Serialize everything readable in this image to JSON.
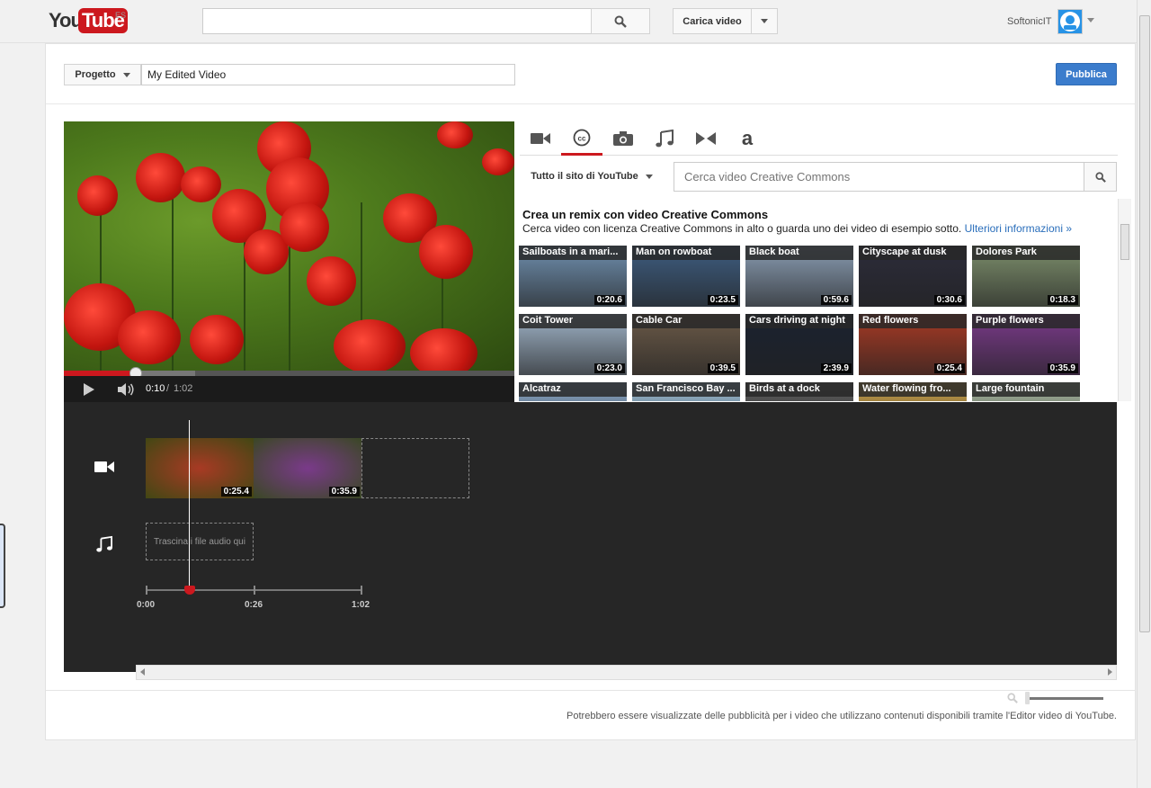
{
  "masthead": {
    "logo_you": "You",
    "logo_tube": "Tube",
    "region": "ES",
    "search_placeholder": "",
    "upload_label": "Carica video",
    "user_name": "SoftonicIT"
  },
  "project": {
    "menu_label": "Progetto",
    "name": "My Edited Video",
    "publish_label": "Pubblica"
  },
  "player": {
    "current_time": "0:10",
    "separator": "/",
    "duration": "1:02",
    "progress_fraction": 0.16
  },
  "tabs": [
    {
      "icon": "video-camera-icon",
      "active": false
    },
    {
      "icon": "creative-commons-icon",
      "active": true
    },
    {
      "icon": "photo-camera-icon",
      "active": false
    },
    {
      "icon": "music-note-icon",
      "active": false
    },
    {
      "icon": "transitions-icon",
      "active": false
    },
    {
      "icon": "text-icon",
      "active": false
    }
  ],
  "cc_panel": {
    "scope_label": "Tutto il sito di YouTube",
    "search_placeholder": "Cerca video Creative Commons",
    "intro_title": "Crea un remix con video Creative Commons",
    "intro_text": "Cerca video con licenza Creative Commons in alto o guarda uno dei video di esempio sotto.",
    "intro_link": "Ulteriori informazioni »",
    "videos": [
      {
        "title": "Sailboats in a mari...",
        "duration": "0:20.6",
        "color": "#6f8fae"
      },
      {
        "title": "Man on rowboat",
        "duration": "0:23.5",
        "color": "#3e5d80"
      },
      {
        "title": "Black boat",
        "duration": "0:59.6",
        "color": "#8a9db3"
      },
      {
        "title": "Cityscape at dusk",
        "duration": "0:30.6",
        "color": "#2c2c3a"
      },
      {
        "title": "Dolores Park",
        "duration": "0:18.3",
        "color": "#7d8f6c"
      },
      {
        "title": "Coit Tower",
        "duration": "0:23.0",
        "color": "#9fb3c7"
      },
      {
        "title": "Cable Car",
        "duration": "0:39.5",
        "color": "#6b5a48"
      },
      {
        "title": "Cars driving at night",
        "duration": "2:39.9",
        "color": "#1a2230"
      },
      {
        "title": "Red flowers",
        "duration": "0:25.4",
        "color": "#a83a24"
      },
      {
        "title": "Purple flowers",
        "duration": "0:35.9",
        "color": "#7a3a8a"
      },
      {
        "title": "Alcatraz",
        "duration": "",
        "color": "#8aa8c8"
      },
      {
        "title": "San Francisco Bay ...",
        "duration": "",
        "color": "#9ec0d8"
      },
      {
        "title": "Birds at a dock",
        "duration": "",
        "color": "#5c5c5c"
      },
      {
        "title": "Water flowing fro...",
        "duration": "",
        "color": "#c8a04a"
      },
      {
        "title": "Large fountain",
        "duration": "",
        "color": "#a8b8a0"
      }
    ]
  },
  "timeline": {
    "clips": [
      {
        "duration": "0:25.4",
        "color": "#a83a24"
      },
      {
        "duration": "0:35.9",
        "color": "#7a3a8a"
      }
    ],
    "audio_drop_label": "Trascina i file audio qui",
    "ruler_labels": [
      "0:00",
      "0:26",
      "1:02"
    ]
  },
  "footer": {
    "note": "Potrebbero essere visualizzate delle pubblicità per i video che utilizzano contenuti disponibili tramite l'Editor video di YouTube."
  },
  "colors": {
    "accent": "#cc181e",
    "publish": "#3b7ccc",
    "link": "#2a6ebb"
  }
}
